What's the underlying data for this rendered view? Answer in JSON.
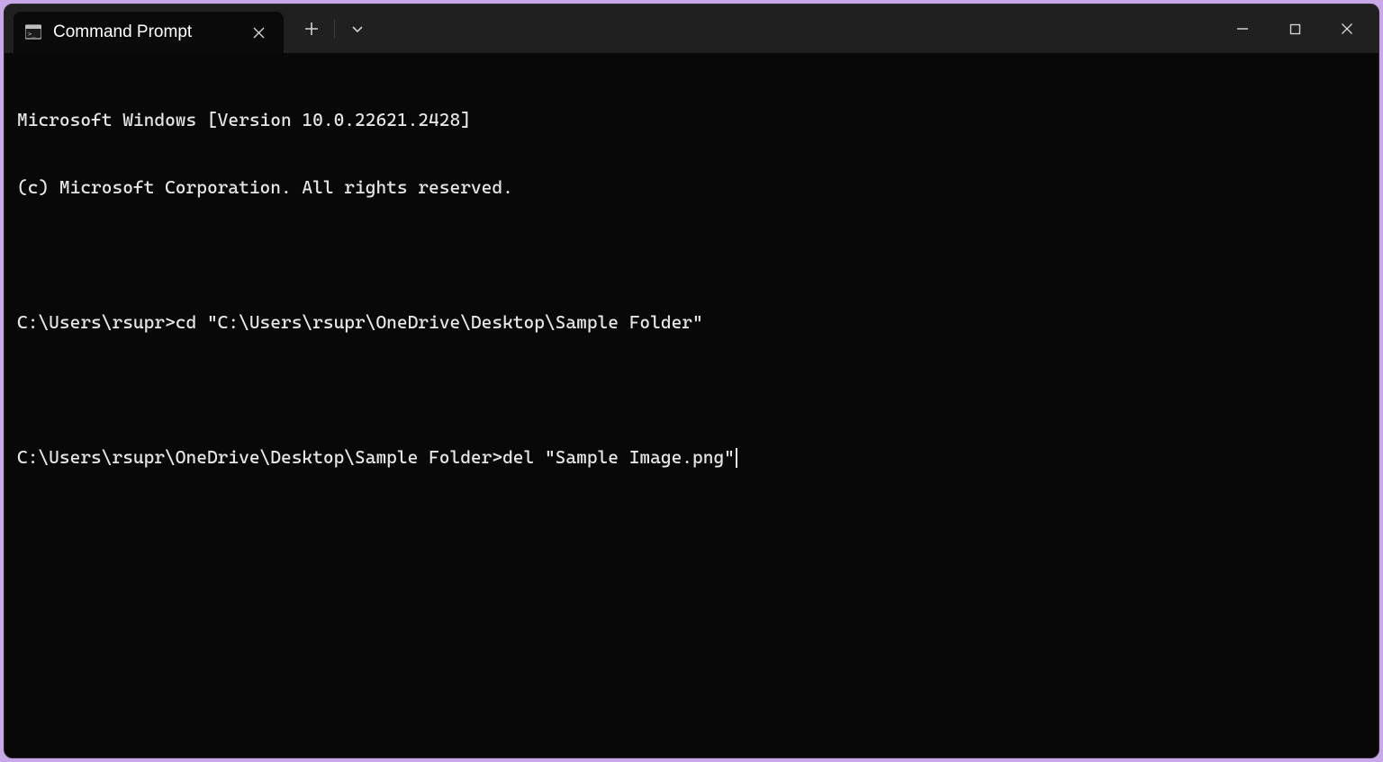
{
  "tab": {
    "title": "Command Prompt",
    "icon": "cmd-icon"
  },
  "terminal": {
    "header1": "Microsoft Windows [Version 10.0.22621.2428]",
    "header2": "(c) Microsoft Corporation. All rights reserved.",
    "prompt1": "C:\\Users\\rsupr>",
    "command1": "cd \"C:\\Users\\rsupr\\OneDrive\\Desktop\\Sample Folder\"",
    "prompt2": "C:\\Users\\rsupr\\OneDrive\\Desktop\\Sample Folder>",
    "command2": "del \"Sample Image.png\""
  }
}
